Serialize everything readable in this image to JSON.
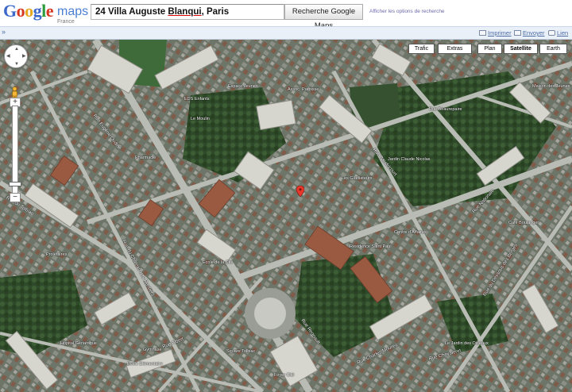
{
  "header": {
    "logo_letters": [
      {
        "ch": "G",
        "color": "#3b68c9"
      },
      {
        "ch": "o",
        "color": "#d6371f"
      },
      {
        "ch": "o",
        "color": "#e6a721"
      },
      {
        "ch": "g",
        "color": "#3b68c9"
      },
      {
        "ch": "l",
        "color": "#2a9b3a"
      },
      {
        "ch": "e",
        "color": "#d6371f"
      }
    ],
    "logo_product": "maps",
    "logo_country": "France",
    "search_value_prefix": "24 Villa Auguste ",
    "search_value_underlined": "Blanqui",
    "search_value_suffix": ", Paris",
    "search_button": "Recherche Google Maps",
    "search_options": "Afficher les options de recherche"
  },
  "toolbar": {
    "collapse": "»",
    "print": "Imprimer",
    "send": "Envoyer",
    "link": "Lien"
  },
  "map_types": {
    "traffic": "Trafic",
    "more": "Extras",
    "map": "Plan",
    "satellite": "Satellite",
    "earth": "Earth",
    "active": "satellite"
  },
  "map": {
    "zoom_in": "+",
    "zoom_out": "−",
    "zoom_level_fraction": 0.93,
    "marker_color": "#e8382b",
    "streets": [
      "Rue Eugène Oudiné",
      "Rue de Tolbiac",
      "Rue du Château des Rentiers",
      "Rue Albert",
      "Rue Regnault",
      "Rue Baudricourt",
      "Rue Nationale",
      "Rue du Dessous des Berges",
      "Rue Chevaleret",
      "Rue Charles Moureu"
    ],
    "places": [
      "Espace Jeunes",
      "EDS Enfants",
      "Le Moulin",
      "Ecole de la Cité",
      "Rue Beaurepaire",
      "Les Gladiateurs",
      "Jardin Claude Nicolas",
      "Assoc. Paroisse",
      "Pharmacie",
      "Centre d'Affaires",
      "Résidence Saint Paul",
      "Prolétaires",
      "Square Tolbiac",
      "Foyer Cité",
      "Hôpital Gériatrique",
      "Gymnase",
      "Ecole Elémentaire",
      "Maison des Jeunes",
      "Café Boulanger",
      "Le Jardin des Oiseaux"
    ]
  }
}
